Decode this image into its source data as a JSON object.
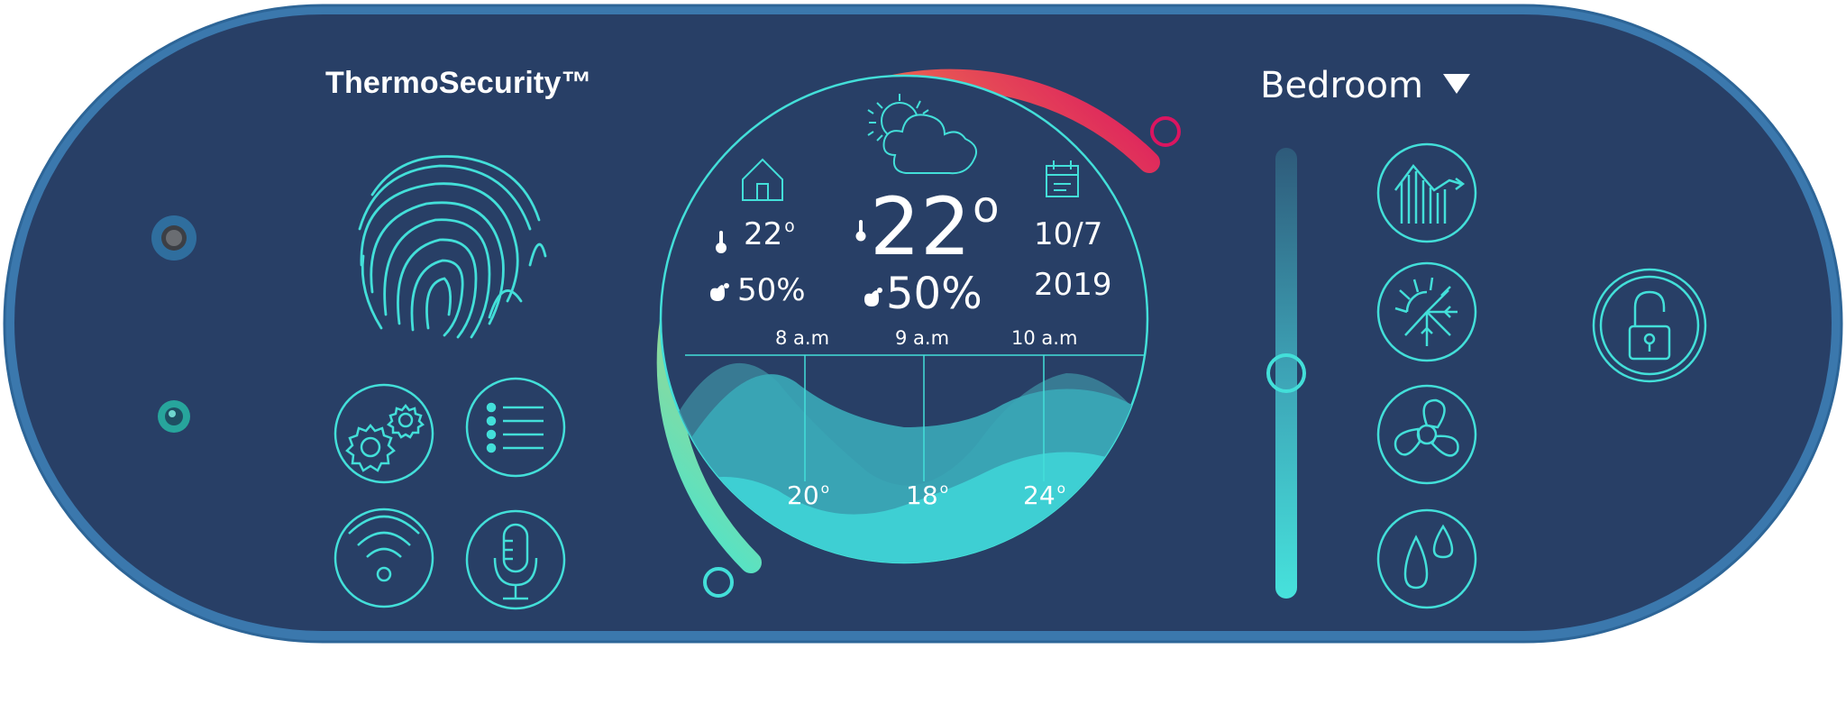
{
  "brand": {
    "name": "ThermoSecurity™"
  },
  "room": {
    "selected": "Bedroom"
  },
  "current": {
    "temperature": "22",
    "humidity": "50%"
  },
  "home": {
    "temperature": "22",
    "humidity": "50%"
  },
  "date": {
    "day_month": "10/7",
    "year": "2019"
  },
  "forecast": {
    "times": [
      "8 a.m",
      "9 a.m",
      "10 a.m"
    ],
    "temps": [
      "20",
      "18",
      "24"
    ]
  },
  "slider": {
    "level": 0.5
  },
  "colors": {
    "panel": "#283f66",
    "rim": "#3b74a7",
    "accent": "#43dfd9",
    "arc_start": "#43e1d7",
    "arc_mid": "#f2a33a",
    "arc_end": "#e0195b"
  },
  "icons": {
    "left": [
      "fingerprint-icon",
      "settings-gears-icon",
      "list-icon",
      "wifi-icon",
      "microphone-icon"
    ],
    "right": [
      "chart-icon",
      "sun-snow-icon",
      "fan-icon",
      "water-drops-icon",
      "unlock-icon"
    ]
  }
}
